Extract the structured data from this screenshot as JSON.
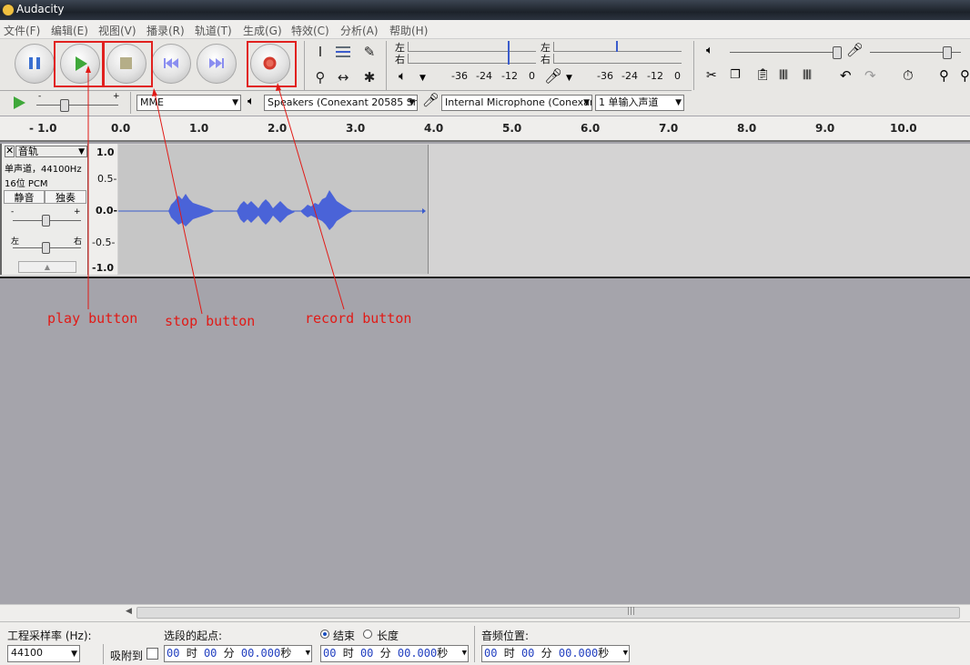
{
  "window": {
    "title": "Audacity"
  },
  "menu": [
    "文件(F)",
    "编辑(E)",
    "视图(V)",
    "播录(R)",
    "轨道(T)",
    "生成(G)",
    "特效(C)",
    "分析(A)",
    "帮助(H)"
  ],
  "meters": {
    "playback_left": "左",
    "playback_right": "右",
    "record_left": "左",
    "record_right": "右",
    "ticks_playback": [
      "-36",
      "-24",
      "-12",
      "0"
    ],
    "ticks_record": [
      "-36",
      "-24",
      "-12",
      "0"
    ]
  },
  "device_toolbar": {
    "host": "MME",
    "output_device": "Speakers (Conexant 20585 Sm",
    "input_device": "Internal Microphone (Conexan",
    "channels": "1 单输入声道"
  },
  "ruler": {
    "ticks": [
      "- 1.0",
      "0.0",
      "1.0",
      "2.0",
      "3.0",
      "4.0",
      "5.0",
      "6.0",
      "7.0",
      "8.0",
      "9.0",
      "10.0"
    ]
  },
  "track": {
    "name": "音轨",
    "info_line1": "单声道，44100Hz",
    "info_line2": "16位 PCM",
    "mute_label": "静音",
    "solo_label": "独奏",
    "gain_minus": "-",
    "gain_plus": "+",
    "pan_left": "左",
    "pan_right": "右",
    "scale": [
      "1.0",
      "0.5-",
      "0.0-",
      "-0.5-",
      "-1.0"
    ]
  },
  "annotations": {
    "play": "play button",
    "stop": "stop button",
    "record": "record button"
  },
  "accent": {
    "annotation": "#e11a16",
    "waveform": "#3b5ccc",
    "play_green": "#3fa83a",
    "record_red": "#d33b2f"
  },
  "selection_bar": {
    "project_rate_label": "工程采样率 (Hz):",
    "project_rate_value": "44100",
    "snap_label": "吸附到",
    "selection_start_label": "选段的起点:",
    "end_radio_label": "结束",
    "length_radio_label": "长度",
    "audio_position_label": "音频位置:",
    "time_start": {
      "h": "00",
      "h_u": "时",
      "m": "00",
      "m_u": "分",
      "s": "00.000",
      "s_u": "秒"
    },
    "time_end": {
      "h": "00",
      "h_u": "时",
      "m": "00",
      "m_u": "分",
      "s": "00.000",
      "s_u": "秒"
    },
    "time_pos": {
      "h": "00",
      "h_u": "时",
      "m": "00",
      "m_u": "分",
      "s": "00.000",
      "s_u": "秒"
    }
  }
}
